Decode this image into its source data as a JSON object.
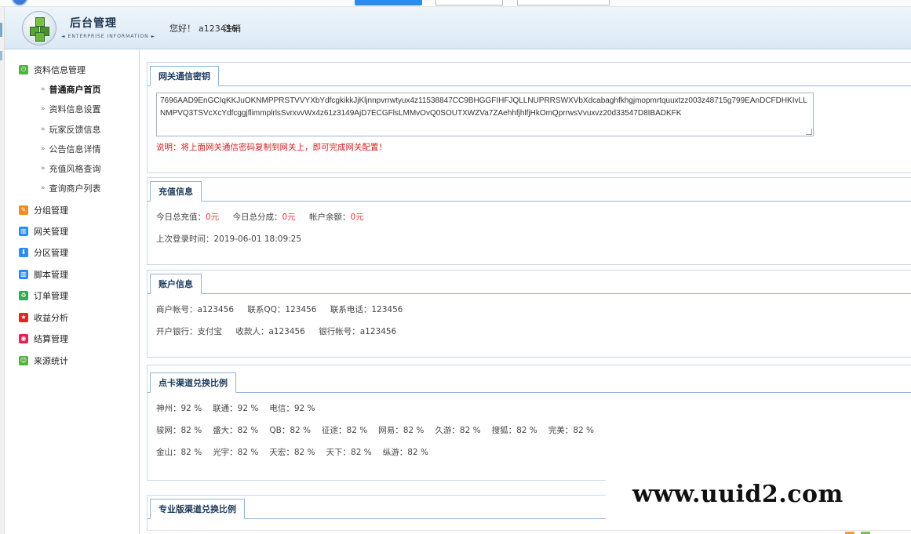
{
  "header": {
    "title": "后台管理",
    "subtitle": "◄ ENTERPRISE INFORMATION ►",
    "greeting": "您好！",
    "username": "a123456",
    "logout_label": "注销"
  },
  "sidebar": {
    "sections": [
      {
        "label": "资料信息管理",
        "icon": "power-icon",
        "color": "#52b043"
      },
      {
        "label": "分组管理",
        "icon": "pencil-icon",
        "color": "#f28b20"
      },
      {
        "label": "网关管理",
        "icon": "grid-icon",
        "color": "#2d8cf0"
      },
      {
        "label": "分区管理",
        "icon": "download-icon",
        "color": "#2d8cf0"
      },
      {
        "label": "脚本管理",
        "icon": "grid-icon",
        "color": "#2d8cf0"
      },
      {
        "label": "订单管理",
        "icon": "recycle-icon",
        "color": "#3aa655"
      },
      {
        "label": "收益分析",
        "icon": "star-icon",
        "color": "#e02424"
      },
      {
        "label": "结算管理",
        "icon": "target-icon",
        "color": "#e02454"
      },
      {
        "label": "来源统计",
        "icon": "smile-icon",
        "color": "#52b043"
      }
    ],
    "sub_items": [
      {
        "label": "普通商户首页",
        "active": true
      },
      {
        "label": "资料信息设置"
      },
      {
        "label": "玩家反馈信息"
      },
      {
        "label": "公告信息详情"
      },
      {
        "label": "充值风格查询"
      },
      {
        "label": "查询商户列表"
      }
    ]
  },
  "gateway_key": {
    "tab": "网关通信密钥",
    "key": "7696AAD9EnGCIqKKJuOKNMPPRSTVVYXbYdfcgkikkJjKljnnpvrrwtyux4z11538847CC9BHGGFIHFJQLLNUPRRSWXVbXdcabaghfkhgjmopmrtquuxtzz003z48715g799EAnDCFDHKIvLLNMPVQ3TSVcXcYdfcggjflimmplrlsSvrxvvWx4z61z3149AjD7ECGFlsLMMvOvQ0SOUTXWZVa7ZAehhfjhlfjHkOmQprrwsVvuxvz20d33547D8IBADKFK",
    "note": "说明：将上面网关通信密码复制到网关上，即可完成网关配置！"
  },
  "recharge": {
    "tab": "充值信息",
    "today_recharge_label": "今日总充值：",
    "today_recharge_value": "0元",
    "today_share_label": "今日总分成：",
    "today_share_value": "0元",
    "balance_label": "帐户余额：",
    "balance_value": "0元",
    "last_login_label": "上次登录时间：",
    "last_login_value": "2019-06-01 18:09:25"
  },
  "account": {
    "tab": "账户信息",
    "merchant_label": "商户帐号：",
    "merchant_value": "a123456",
    "qq_label": "联系QQ：",
    "qq_value": "123456",
    "phone_label": "联系电话：",
    "phone_value": "123456",
    "bank_label": "开户银行：",
    "bank_value": "支付宝",
    "payee_label": "收款人：",
    "payee_value": "a123456",
    "bank_account_label": "银行帐号：",
    "bank_account_value": "a123456"
  },
  "card_rates": {
    "tab": "点卡渠道兑换比例",
    "rows": [
      [
        "神州：92 %",
        "联通：92 %",
        "电信：92 %"
      ],
      [
        "骏网：82 %",
        "盛大：82 %",
        "QB：82 %",
        "征途：82 %",
        "网易：82 %",
        "久游：82 %",
        "搜狐：82 %",
        "完美：82 %"
      ],
      [
        "金山：82 %",
        "光宇：82 %",
        "天宏：82 %",
        "天下：82 %",
        "纵游：82 %"
      ]
    ]
  },
  "pro_rates": {
    "tab": "专业版渠道兑换比例"
  },
  "watermark": "www.uuid2.com"
}
